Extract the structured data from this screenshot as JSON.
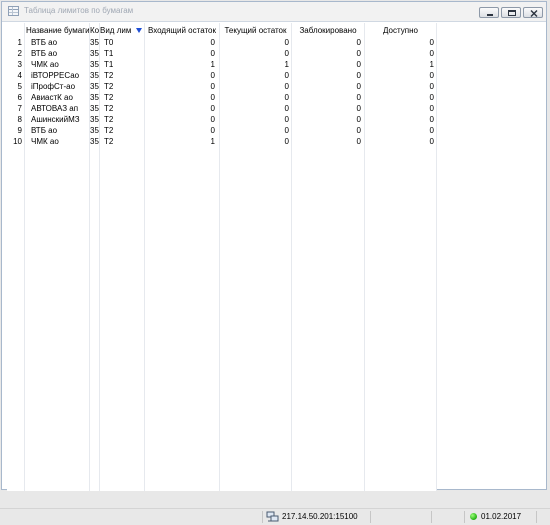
{
  "window": {
    "title": "Таблица лимитов по бумагам"
  },
  "table": {
    "columns": {
      "num": "",
      "name": "Название бумаги",
      "code": "Ко",
      "limit_type": "Вид лим",
      "incoming": "Входящий остаток",
      "current": "Текущий остаток",
      "blocked": "Заблокировано",
      "available": "Доступно"
    },
    "sort": {
      "column": "Вид лим",
      "direction": "descending",
      "icon": "arrow-down-icon"
    },
    "rows": [
      {
        "num": "1",
        "name": "ВТБ ао",
        "code": "35",
        "limit_type": "T0",
        "incoming": "0",
        "current": "0",
        "blocked": "0",
        "available": "0"
      },
      {
        "num": "2",
        "name": "ВТБ ао",
        "code": "35",
        "limit_type": "T1",
        "incoming": "0",
        "current": "0",
        "blocked": "0",
        "available": "0"
      },
      {
        "num": "3",
        "name": "ЧМК ао",
        "code": "35",
        "limit_type": "T1",
        "incoming": "1",
        "current": "1",
        "blocked": "0",
        "available": "1"
      },
      {
        "num": "4",
        "name": "iВТОРРЕСао",
        "code": "35",
        "limit_type": "T2",
        "incoming": "0",
        "current": "0",
        "blocked": "0",
        "available": "0"
      },
      {
        "num": "5",
        "name": "iПрофСт-ао",
        "code": "35",
        "limit_type": "T2",
        "incoming": "0",
        "current": "0",
        "blocked": "0",
        "available": "0"
      },
      {
        "num": "6",
        "name": "АвиастК ао",
        "code": "35",
        "limit_type": "T2",
        "incoming": "0",
        "current": "0",
        "blocked": "0",
        "available": "0"
      },
      {
        "num": "7",
        "name": "АВТОВАЗ ап",
        "code": "35",
        "limit_type": "T2",
        "incoming": "0",
        "current": "0",
        "blocked": "0",
        "available": "0"
      },
      {
        "num": "8",
        "name": "АшинскийМЗ",
        "code": "35",
        "limit_type": "T2",
        "incoming": "0",
        "current": "0",
        "blocked": "0",
        "available": "0"
      },
      {
        "num": "9",
        "name": "ВТБ ао",
        "code": "35",
        "limit_type": "T2",
        "incoming": "0",
        "current": "0",
        "blocked": "0",
        "available": "0"
      },
      {
        "num": "10",
        "name": "ЧМК ао",
        "code": "35",
        "limit_type": "T2",
        "incoming": "1",
        "current": "0",
        "blocked": "0",
        "available": "0"
      }
    ]
  },
  "statusbar": {
    "server": "217.14.50.201:15100",
    "server_icon": "server-connection-icon",
    "status_color": "#22b012",
    "date": "01.02.2017"
  }
}
